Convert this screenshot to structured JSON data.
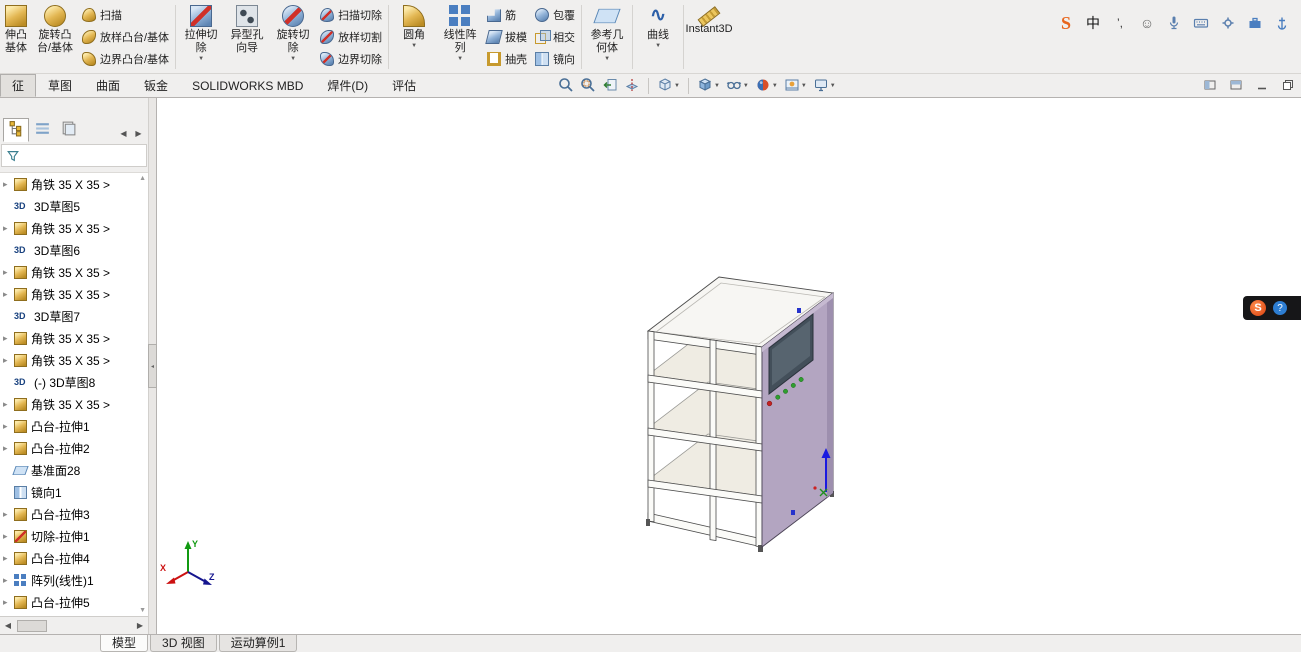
{
  "colors": {
    "ribbon_bg": "#f0efee",
    "viewport_bg": "#ffffff",
    "cabinet_panel": "#b3a5c1",
    "cabinet_panel_shade": "#9d8fae",
    "screen": "#434f5a",
    "triad_x": "#cc1111",
    "triad_y": "#119911",
    "triad_z": "#15158f",
    "tray_logo_orange": "#e8651c"
  },
  "ribbon": {
    "groups": [
      {
        "type": "big",
        "clipped": true,
        "icon": "boss-extrude-icon",
        "name": "extruded-boss-button",
        "label": "伸凸\n基体"
      },
      {
        "type": "big",
        "icon": "revolve-boss-icon",
        "name": "revolved-boss-button",
        "label": "旋转凸\n台/基体"
      },
      {
        "type": "stack",
        "items": [
          {
            "icon": "sweep-icon",
            "name": "swept-boss-button",
            "label": "扫描"
          },
          {
            "icon": "loft-icon",
            "name": "lofted-boss-button",
            "label": "放样凸台/基体"
          },
          {
            "icon": "boundary-icon",
            "name": "boundary-boss-button",
            "label": "边界凸台/基体"
          }
        ]
      },
      {
        "type": "sep"
      },
      {
        "type": "big",
        "icon": "extruded-cut-icon",
        "name": "extruded-cut-button",
        "label": "拉伸切\n除",
        "caret": true
      },
      {
        "type": "big",
        "icon": "hole-wizard-icon",
        "name": "hole-wizard-button",
        "label": "异型孔\n向导"
      },
      {
        "type": "big",
        "icon": "revolved-cut-icon",
        "name": "revolved-cut-button",
        "label": "旋转切\n除",
        "caret": true
      },
      {
        "type": "stack",
        "items": [
          {
            "icon": "swept-cut-icon",
            "name": "swept-cut-button",
            "label": "扫描切除"
          },
          {
            "icon": "lofted-cut-icon",
            "name": "lofted-cut-button",
            "label": "放样切割"
          },
          {
            "icon": "boundary-cut-icon",
            "name": "boundary-cut-button",
            "label": "边界切除"
          }
        ]
      },
      {
        "type": "sep"
      },
      {
        "type": "big",
        "icon": "fillet-icon",
        "name": "fillet-button",
        "label": "圆角",
        "caret": true
      },
      {
        "type": "big",
        "icon": "linear-pattern-icon",
        "name": "linear-pattern-button",
        "label": "线性阵\n列",
        "caret": true
      },
      {
        "type": "stack",
        "items": [
          {
            "icon": "rib-icon",
            "name": "rib-button",
            "label": "筋"
          },
          {
            "icon": "draft-icon",
            "name": "draft-button",
            "label": "拔模"
          },
          {
            "icon": "shell-icon",
            "name": "shell-button",
            "label": "抽壳"
          }
        ]
      },
      {
        "type": "stack",
        "items": [
          {
            "icon": "wrap-icon",
            "name": "wrap-button",
            "label": "包覆"
          },
          {
            "icon": "intersect-icon",
            "name": "intersect-button",
            "label": "相交"
          },
          {
            "icon": "mirror-icon",
            "name": "mirror-button",
            "label": "镜向"
          }
        ]
      },
      {
        "type": "sep"
      },
      {
        "type": "big",
        "icon": "reference-geometry-icon",
        "name": "reference-geometry-button",
        "label": "参考几\n何体",
        "caret": true
      },
      {
        "type": "sep"
      },
      {
        "type": "big",
        "icon": "curves-icon",
        "name": "curves-button",
        "label": "曲线",
        "caret": true
      },
      {
        "type": "sep"
      },
      {
        "type": "big",
        "icon": "instant3d-icon",
        "name": "instant3d-button",
        "label": "Instant3D"
      }
    ]
  },
  "feature_tabs": [
    {
      "name": "tab-features",
      "label": "征",
      "active": true
    },
    {
      "name": "tab-sketch",
      "label": "草图"
    },
    {
      "name": "tab-surfaces",
      "label": "曲面"
    },
    {
      "name": "tab-sheet-metal",
      "label": "钣金"
    },
    {
      "name": "tab-solidworks-mbd",
      "label": "SOLIDWORKS MBD"
    },
    {
      "name": "tab-weldments",
      "label": "焊件(D)"
    },
    {
      "name": "tab-evaluate",
      "label": "评估"
    }
  ],
  "headsup": [
    {
      "name": "zoom-to-fit-icon"
    },
    {
      "name": "zoom-to-area-icon"
    },
    {
      "name": "previous-view-icon"
    },
    {
      "name": "section-view-icon",
      "sep_after": true
    },
    {
      "name": "view-orientation-icon",
      "caret": true,
      "sep_after": true
    },
    {
      "name": "display-style-icon",
      "caret": true
    },
    {
      "name": "hide-show-items-icon",
      "caret": true
    },
    {
      "name": "edit-appearance-icon",
      "caret": true
    },
    {
      "name": "apply-scene-icon",
      "caret": true
    },
    {
      "name": "view-settings-icon",
      "caret": true
    }
  ],
  "window_buttons": [
    {
      "name": "tile-horizontal-button",
      "icon": "tile-horizontal"
    },
    {
      "name": "tile-vertical-button",
      "icon": "tile-vertical"
    },
    {
      "name": "minimize-button",
      "icon": "minimize"
    },
    {
      "name": "restore-button",
      "icon": "restore"
    }
  ],
  "ime": [
    {
      "name": "solidworks-tray-icon",
      "text": "S"
    },
    {
      "name": "ime-language-icon",
      "text": "中"
    },
    {
      "name": "ime-punctuation-icon",
      "text": "’,"
    },
    {
      "name": "ime-emoji-icon",
      "text": "☺"
    },
    {
      "name": "ime-mic-icon",
      "svg": "mic"
    },
    {
      "name": "ime-keyboard-icon",
      "svg": "keyboard"
    },
    {
      "name": "ime-settings-icon",
      "svg": "settings"
    },
    {
      "name": "tray-briefcase-icon",
      "svg": "briefcase"
    },
    {
      "name": "tray-pin-icon",
      "svg": "pin"
    }
  ],
  "feature_panel": {
    "tabs": [
      {
        "name": "featuremanager-tab",
        "icon": "featuremanager",
        "active": true
      },
      {
        "name": "propertymanager-tab",
        "icon": "propertymanager"
      },
      {
        "name": "configurationmanager-tab",
        "icon": "configurationmanager"
      }
    ],
    "filter_placeholder": "",
    "items": [
      {
        "arrow": true,
        "icon": "part",
        "label": "角铁 35 X 35 >"
      },
      {
        "icon": "sketch3d",
        "label": "3D草图5"
      },
      {
        "arrow": true,
        "icon": "part",
        "label": "角铁 35 X 35 >"
      },
      {
        "icon": "sketch3d",
        "label": "3D草图6"
      },
      {
        "arrow": true,
        "icon": "part",
        "label": "角铁 35 X 35 >"
      },
      {
        "arrow": true,
        "icon": "part",
        "label": "角铁 35 X 35 >"
      },
      {
        "icon": "sketch3d",
        "label": "3D草图7"
      },
      {
        "arrow": true,
        "icon": "part",
        "label": "角铁 35 X 35 >"
      },
      {
        "arrow": true,
        "icon": "part",
        "label": "角铁 35 X 35 >"
      },
      {
        "icon": "sketch3d",
        "label": "(-) 3D草图8"
      },
      {
        "arrow": true,
        "icon": "part",
        "label": "角铁 35 X 35 >"
      },
      {
        "arrow": true,
        "icon": "boss",
        "label": "凸台-拉伸1"
      },
      {
        "arrow": true,
        "icon": "boss",
        "label": "凸台-拉伸2"
      },
      {
        "icon": "plane",
        "label": "基准面28"
      },
      {
        "icon": "mirror",
        "label": "镜向1"
      },
      {
        "arrow": true,
        "icon": "boss",
        "label": "凸台-拉伸3"
      },
      {
        "arrow": true,
        "icon": "cut",
        "label": "切除-拉伸1"
      },
      {
        "arrow": true,
        "icon": "boss",
        "label": "凸台-拉伸4"
      },
      {
        "arrow": true,
        "icon": "pattern",
        "label": "阵列(线性)1"
      },
      {
        "arrow": true,
        "icon": "boss",
        "label": "凸台-拉伸5"
      }
    ]
  },
  "bottom_bar": {
    "tabs": [
      {
        "name": "tab-model",
        "label": "模型",
        "active": true
      },
      {
        "name": "tab-3d-views",
        "label": "3D 视图"
      },
      {
        "name": "tab-motion-study-1",
        "label": "运动算例1"
      }
    ]
  },
  "resources_flyout": {
    "logo_text": "S",
    "help_text": "?"
  }
}
